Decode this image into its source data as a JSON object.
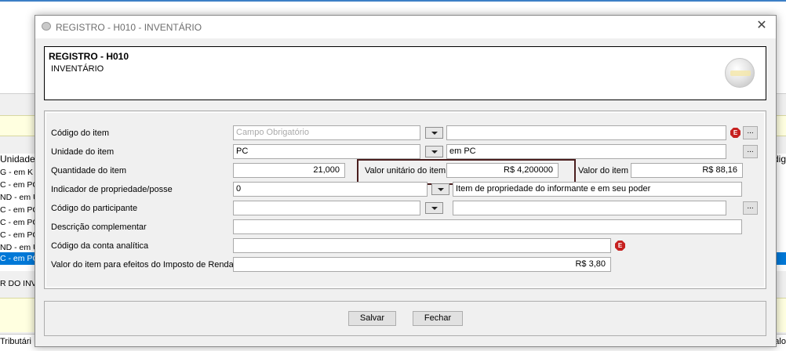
{
  "background": {
    "list_header": "Unidade",
    "list_header_right": "ódig",
    "rows": [
      "G - em K",
      "C - em PC",
      "ND - em U",
      "C - em PC",
      "C - em PC",
      "C - em PC",
      "ND - em U",
      "C - em PC"
    ],
    "inventory_label": "R DO INVE",
    "bottom_left": "Tributári",
    "bottom_right": "/alo"
  },
  "dialog": {
    "title": "REGISTRO - H010 - INVENTÁRIO",
    "header_title": "REGISTRO - H010",
    "header_subtitle": "INVENTÁRIO",
    "error_icon_text": "E",
    "dots_label": "...",
    "fields": {
      "codigo_item": {
        "label": "Código do item",
        "placeholder": "Campo Obrigatório",
        "desc": ""
      },
      "unidade_item": {
        "label": "Unidade do item",
        "value": "PC",
        "desc": "em PC"
      },
      "quantidade_item": {
        "label": "Quantidade do item",
        "value": "21,000"
      },
      "valor_unitario": {
        "label": "Valor unitário do item",
        "value": "R$ 4,200000"
      },
      "valor_item": {
        "label": "Valor do item",
        "value": "R$ 88,16"
      },
      "indicador_propriedade": {
        "label": "Indicador de propriedade/posse",
        "value": "0",
        "desc": "Item de propriedade do informante e em seu poder"
      },
      "codigo_participante": {
        "label": "Código do participante",
        "value": "",
        "desc": ""
      },
      "descricao_complementar": {
        "label": "Descrição complementar",
        "value": ""
      },
      "codigo_conta": {
        "label": "Código da conta analítica",
        "value": ""
      },
      "valor_ir": {
        "label": "Valor do item para efeitos do Imposto de Renda",
        "value": "R$ 3,80"
      }
    },
    "buttons": {
      "save": "Salvar",
      "close": "Fechar"
    }
  },
  "colors": {
    "selection": "#0078d7",
    "error": "#c6201f",
    "highlight_border": "#4a1e1e",
    "notice_bg": "#ffffe0"
  }
}
